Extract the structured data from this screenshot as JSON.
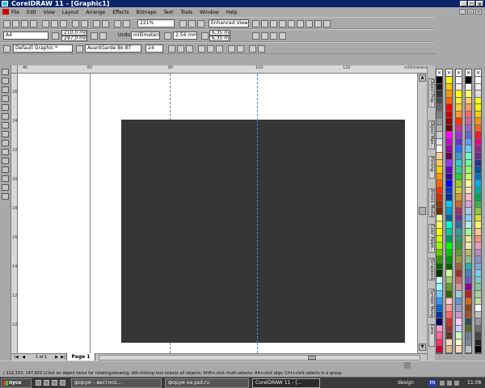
{
  "window": {
    "title": "CorelDRAW 11 - [Graphic1]"
  },
  "menu": [
    "File",
    "Edit",
    "View",
    "Layout",
    "Arrange",
    "Effects",
    "Bitmaps",
    "Text",
    "Tools",
    "Window",
    "Help"
  ],
  "toolbar": {
    "zoom_value": "221%",
    "view_mode": "Enhanced View"
  },
  "property_bar": {
    "paper_size": "A4",
    "width": "210,0 mm",
    "height": "297,0 mm",
    "units_label": "Units:",
    "units_value": "millimeters",
    "nudge_value": "2,54 mm",
    "duplicate_x": "6,35 mm",
    "duplicate_y": "6,35 mm"
  },
  "text_bar": {
    "style": "Default Graphic *",
    "font": "AvantGarde Bk BT",
    "size": "24"
  },
  "ruler": {
    "units": "millimeters",
    "h_labels": [
      "40",
      "60",
      "80",
      "100",
      "120"
    ],
    "v_labels": [
      "260",
      "240",
      "220",
      "200",
      "180",
      "160",
      "140",
      "120",
      "100"
    ]
  },
  "dockers": [
    "Object Prop...",
    "Object Man...",
    "Hinting",
    "Artistic Media",
    "Color Palett...",
    "Scrapbook",
    "Symbol Mana...",
    "Lens"
  ],
  "document": {
    "page_count": "1 of 1",
    "page_tab": "Page 1"
  },
  "status": {
    "coords": "( 122,153; 147,823 )",
    "hint": "Click an object twice for rotating/skewing; dbl-clicking tool selects all objects; Shift+click multi-selects; Alt+click digs; Ctrl+click selects in a group"
  },
  "taskbar": {
    "start": "пуск",
    "tasks": [
      "форум – вестосо...",
      "форум на psd.ru",
      "CorelDRAW 11 - [..."
    ],
    "tray_text": "design",
    "lang": "EN",
    "clock": "11:08"
  },
  "palette_colors": [
    [
      "#000000",
      "#1a1a1a",
      "#333333",
      "#4d4d4d",
      "#666666",
      "#808080",
      "#999999",
      "#b3b3b3",
      "#cccccc",
      "#e6e6e6",
      "#ffffff",
      "#ffcc99",
      "#ffcc66",
      "#ffcc00",
      "#ff9900",
      "#ff6600",
      "#ff3300",
      "#cc3300",
      "#993300",
      "#663300",
      "#ffff99",
      "#ffff66",
      "#ffff00",
      "#ccff00",
      "#99ff00",
      "#66cc00",
      "#339900",
      "#006600",
      "#003300",
      "#ccffff",
      "#99ffff",
      "#66ccff",
      "#3399ff",
      "#0066cc",
      "#003399",
      "#000066",
      "#ff99cc",
      "#ff6699",
      "#ff3366",
      "#cc0033"
    ],
    [
      "#ffff00",
      "#ffcc00",
      "#ff9900",
      "#ff6600",
      "#ff0000",
      "#cc0000",
      "#990000",
      "#660000",
      "#ff00ff",
      "#cc00cc",
      "#990099",
      "#660066",
      "#9933ff",
      "#6600cc",
      "#330099",
      "#0000ff",
      "#0033cc",
      "#003399",
      "#00ccff",
      "#0099cc",
      "#006699",
      "#00ffcc",
      "#00cc99",
      "#009966",
      "#00ff00",
      "#00cc00",
      "#009900",
      "#006600",
      "#ccff99",
      "#99cc66",
      "#669933",
      "#336600",
      "#ffcccc",
      "#ff9999",
      "#ff6666",
      "#cc3333",
      "#993333",
      "#663333",
      "#f5deb3",
      "#deb887"
    ],
    [
      "#ffffff",
      "#f0f0f0",
      "#ffff00",
      "#ffeb3b",
      "#ffcc33",
      "#ff9933",
      "#ff3300",
      "#cc3399",
      "#9933cc",
      "#6633cc",
      "#3366ff",
      "#3399cc",
      "#33cccc",
      "#33cc99",
      "#33cc33",
      "#99cc33",
      "#cccc33",
      "#cc9933",
      "#cc6633",
      "#993366",
      "#663399",
      "#336699",
      "#339999",
      "#339966",
      "#339933",
      "#669933",
      "#999933",
      "#996633",
      "#993333",
      "#cc6666",
      "#cc9999",
      "#99cccc",
      "#6699cc",
      "#9999cc",
      "#cc99cc",
      "#ffccff",
      "#ccccff",
      "#ccffcc",
      "#ffffcc",
      "#ffdab9"
    ],
    [
      "#000000",
      "#ffffff",
      "#ffff66",
      "#ffcc66",
      "#ff9966",
      "#ff6666",
      "#cc6699",
      "#9966cc",
      "#6666cc",
      "#6699ff",
      "#66ccff",
      "#66ffcc",
      "#66ff99",
      "#99ff66",
      "#ccff66",
      "#ffff99",
      "#ffe4b5",
      "#ffb6c1",
      "#dda0dd",
      "#b0c4de",
      "#87cefa",
      "#afeeee",
      "#98fb98",
      "#f0e68c",
      "#eee8aa",
      "#bdb76b",
      "#8fbc8f",
      "#20b2aa",
      "#4682b4",
      "#6a5acd",
      "#8b008b",
      "#b22222",
      "#d2691e",
      "#8b4513",
      "#a0522d",
      "#2f4f4f",
      "#556b2f",
      "#708090",
      "#778899",
      "#c0c0c0"
    ],
    [
      "#ffffff",
      "#eeeeee",
      "#dddddd",
      "#ffff00",
      "#fff200",
      "#ffcb05",
      "#f7941d",
      "#f26522",
      "#ed1c24",
      "#ec008c",
      "#92278f",
      "#662d91",
      "#2e3192",
      "#0054a6",
      "#0072bc",
      "#00aeef",
      "#00a99d",
      "#00a651",
      "#39b54a",
      "#8dc63f",
      "#d7df23",
      "#fff568",
      "#fdc689",
      "#f69679",
      "#f49ac1",
      "#bd8cbf",
      "#8393ca",
      "#7da7d9",
      "#6dcff6",
      "#7accc8",
      "#82ca9c",
      "#a3d39c",
      "#c4df9b",
      "#ffffff",
      "#c2c2c2",
      "#959595",
      "#6d6d6d",
      "#464646",
      "#252525",
      "#000000"
    ]
  ]
}
